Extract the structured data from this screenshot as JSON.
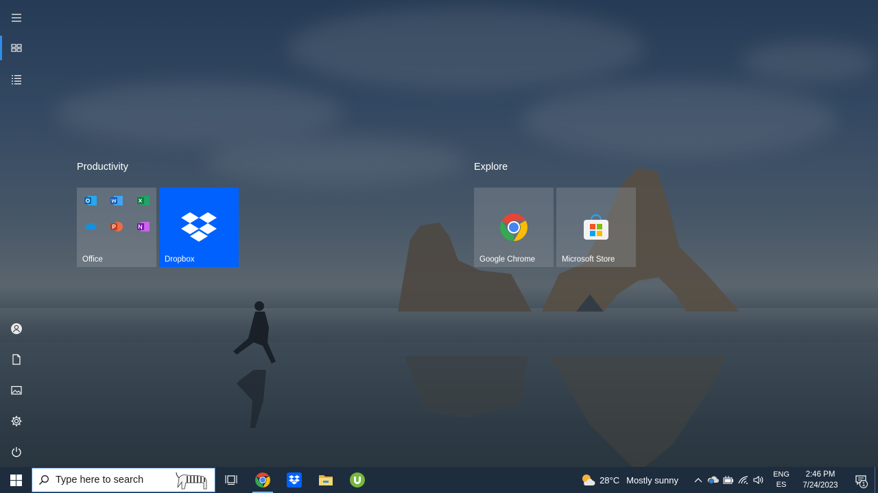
{
  "start_menu": {
    "rail": {
      "items": [
        {
          "icon": "hamburger-icon"
        },
        {
          "icon": "pinned-tiles-icon",
          "active": true
        },
        {
          "icon": "all-apps-list-icon"
        },
        {
          "icon": "user-account-icon"
        },
        {
          "icon": "documents-icon"
        },
        {
          "icon": "pictures-icon"
        },
        {
          "icon": "settings-gear-icon"
        },
        {
          "icon": "power-icon"
        }
      ]
    },
    "groups": [
      {
        "title": "Productivity",
        "tiles": [
          {
            "label": "Office",
            "icon": "office-apps-icon"
          },
          {
            "label": "Dropbox",
            "icon": "dropbox-icon",
            "color": "#0061fe"
          }
        ]
      },
      {
        "title": "Explore",
        "tiles": [
          {
            "label": "Google Chrome",
            "icon": "chrome-icon"
          },
          {
            "label": "Microsoft Store",
            "icon": "store-icon"
          }
        ]
      }
    ]
  },
  "taskbar": {
    "search": {
      "placeholder": "Type here to search"
    },
    "apps": [
      {
        "icon": "task-view-icon"
      },
      {
        "icon": "chrome-icon",
        "running": true
      },
      {
        "icon": "dropbox-icon"
      },
      {
        "icon": "file-explorer-icon"
      },
      {
        "icon": "utorrent-icon"
      }
    ],
    "weather": {
      "temp": "28°C",
      "condition": "Mostly sunny"
    },
    "language": {
      "line1": "ENG",
      "line2": "ES"
    },
    "clock": {
      "time": "2:46 PM",
      "date": "7/24/2023"
    },
    "notifications": {
      "count": "1"
    }
  },
  "colors": {
    "accent": "#2e8ee8",
    "taskbar": "#1d2d3e",
    "dropbox": "#0061fe"
  }
}
